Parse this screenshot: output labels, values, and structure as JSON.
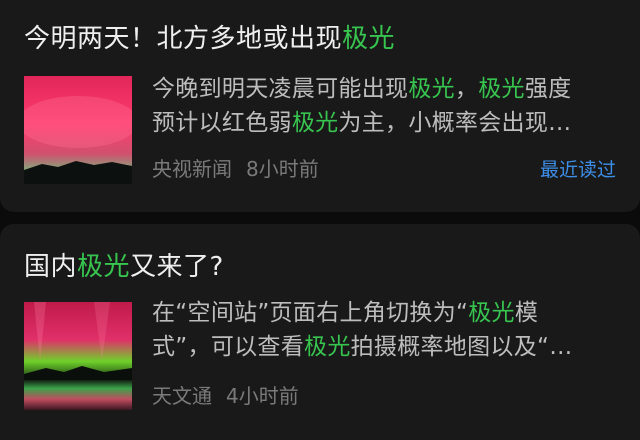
{
  "colors": {
    "background": "#0b0b0b",
    "card": "#191919",
    "highlight": "#37c44f",
    "link": "#3d8ee8",
    "meta": "#7a7a7a"
  },
  "articles": [
    {
      "title": {
        "before": "今明两天！北方多地或出现",
        "highlight": "极光"
      },
      "thumbnail": "aurora-red-sky-photo",
      "snippet": {
        "line1": {
          "a": "今晚到明天凌晨可能出现",
          "b": "极光",
          "c": "，",
          "d": "极光",
          "e": "强度"
        },
        "line2": {
          "a": "预计以红色弱",
          "b": "极光",
          "c": "为主，小概率会出现…"
        }
      },
      "source": "央视新闻",
      "time": "8小时前",
      "badge": "最近读过"
    },
    {
      "title": {
        "before": "国内",
        "highlight": "极光",
        "after": "又来了?"
      },
      "thumbnail": "aurora-green-red-lake-photo",
      "snippet": {
        "line1": {
          "a": "在“空间站”页面右上角切换为“",
          "b": "极光",
          "c": "模"
        },
        "line2": {
          "a": "式”，可以查看",
          "b": "极光",
          "c": "拍摄概率地图以及“…"
        }
      },
      "source": "天文通",
      "time": "4小时前"
    }
  ]
}
